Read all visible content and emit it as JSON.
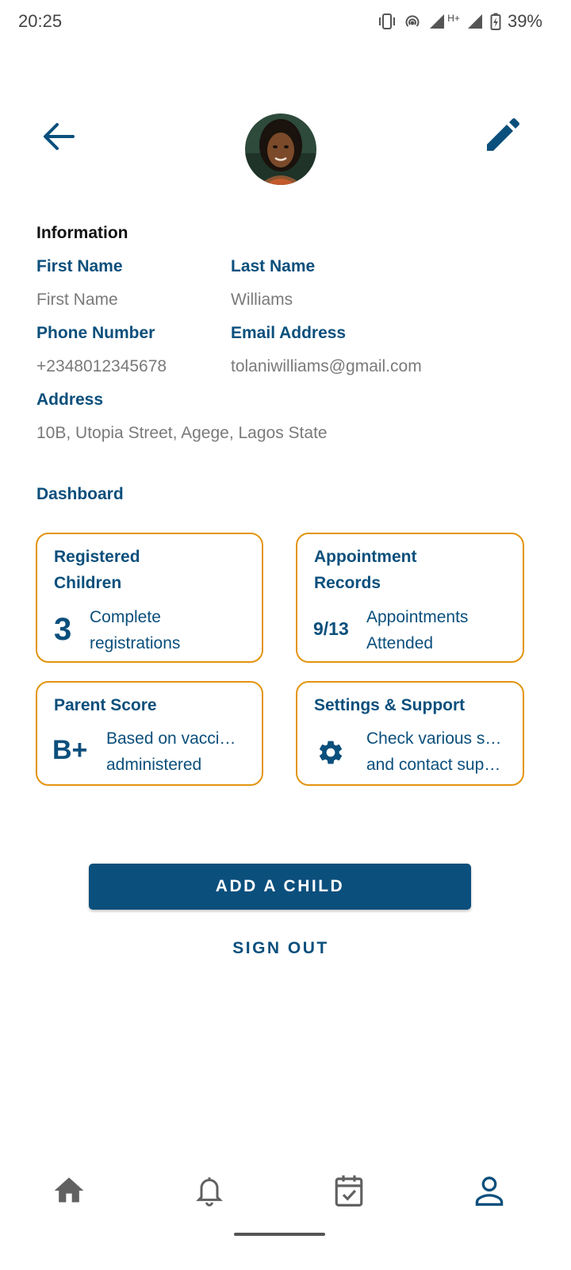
{
  "status_bar": {
    "time": "20:25",
    "network": "H+",
    "battery": "39%",
    "icons": [
      "vibrate-icon",
      "hotspot-icon",
      "signal-icon",
      "battery-charging-icon"
    ]
  },
  "header": {
    "back_icon": "arrow-left-icon",
    "edit_icon": "pencil-icon",
    "avatar": "profile-photo"
  },
  "information": {
    "title": "Information",
    "first_name": {
      "label": "First Name",
      "value": "First Name"
    },
    "last_name": {
      "label": "Last Name",
      "value": "Williams"
    },
    "phone": {
      "label": "Phone Number",
      "value": "+2348012345678"
    },
    "email": {
      "label": "Email Address",
      "value": "tolaniwilliams@gmail.com"
    },
    "address": {
      "label": "Address",
      "value": "10B, Utopia Street, Agege, Lagos State"
    }
  },
  "dashboard": {
    "title": "Dashboard",
    "cards": [
      {
        "title_line1": "Registered",
        "title_line2": "Children",
        "big": "3",
        "desc_line1": "Complete",
        "desc_line2": "registrations"
      },
      {
        "title_line1": "Appointment",
        "title_line2": "Records",
        "big": "9/13",
        "desc_line1": "Appointments",
        "desc_line2": "Attended"
      },
      {
        "title_line1": "Parent Score",
        "big": "B+",
        "desc_line1": "Based on vaccines",
        "desc_line2": "administered"
      },
      {
        "title_line1": "Settings & Support",
        "icon": "gear-icon",
        "desc_line1": "Check various settings",
        "desc_line2": "and contact support"
      }
    ]
  },
  "actions": {
    "add_child": "ADD A CHILD",
    "sign_out": "SIGN OUT"
  },
  "bottom_nav": {
    "items": [
      "home-icon",
      "bell-icon",
      "calendar-check-icon",
      "person-icon"
    ],
    "active": "person-icon",
    "colors": {
      "inactive": "#616161",
      "active": "#0b4f7c"
    }
  },
  "colors": {
    "primary": "#0b4f7c",
    "card_border": "#e3940f",
    "value_text": "#7a7a7a"
  }
}
